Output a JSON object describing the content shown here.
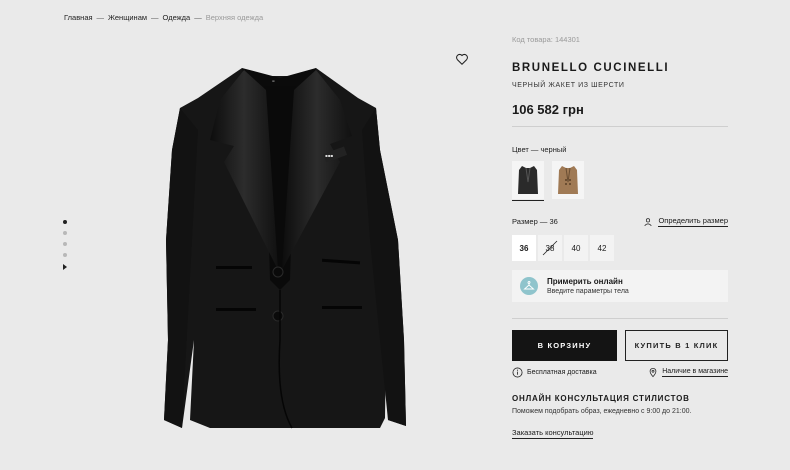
{
  "breadcrumb": {
    "items": [
      "Главная",
      "Женщинам",
      "Одежда"
    ],
    "separator": "—",
    "current": "Верхняя одежда"
  },
  "gallery": {
    "slides_count": 5,
    "active_slide": 1,
    "image_icon": "black-blazer-photo"
  },
  "product": {
    "sku": "Код товара: 144301",
    "brand": "BRUNELLO CUCINELLI",
    "name": "ЧЕРНЫЙ ЖАКЕТ ИЗ ШЕРСТИ",
    "price": "106 582 грн",
    "color_label": "Цвет — черный",
    "colors": [
      {
        "name": "черный",
        "hex": "#2a2a2a",
        "selected": true
      },
      {
        "name": "бежевый",
        "hex": "#a07a55",
        "selected": false
      }
    ],
    "size_label": "Размер — 36",
    "size_help": "Определить размер",
    "sizes": [
      {
        "label": "36",
        "selected": true,
        "available": true
      },
      {
        "label": "38",
        "selected": false,
        "available": false
      },
      {
        "label": "40",
        "selected": false,
        "available": true
      },
      {
        "label": "42",
        "selected": false,
        "available": true
      }
    ]
  },
  "tryon": {
    "title": "Примерить онлайн",
    "subtitle": "Введите параметры тела",
    "icon_color": "#8fc4cc"
  },
  "actions": {
    "cart": "В КОРЗИНУ",
    "one_click": "КУПИТЬ В 1 КЛИК"
  },
  "delivery": {
    "free": "Бесплатная доставка",
    "in_store": "Наличие в магазине"
  },
  "consultation": {
    "title": "ОНЛАЙН КОНСУЛЬТАЦИЯ СТИЛИСТОВ",
    "subtitle": "Поможем подобрать образ, ежедневно с 9:00 до 21:00.",
    "link": "Заказать консультацию"
  }
}
